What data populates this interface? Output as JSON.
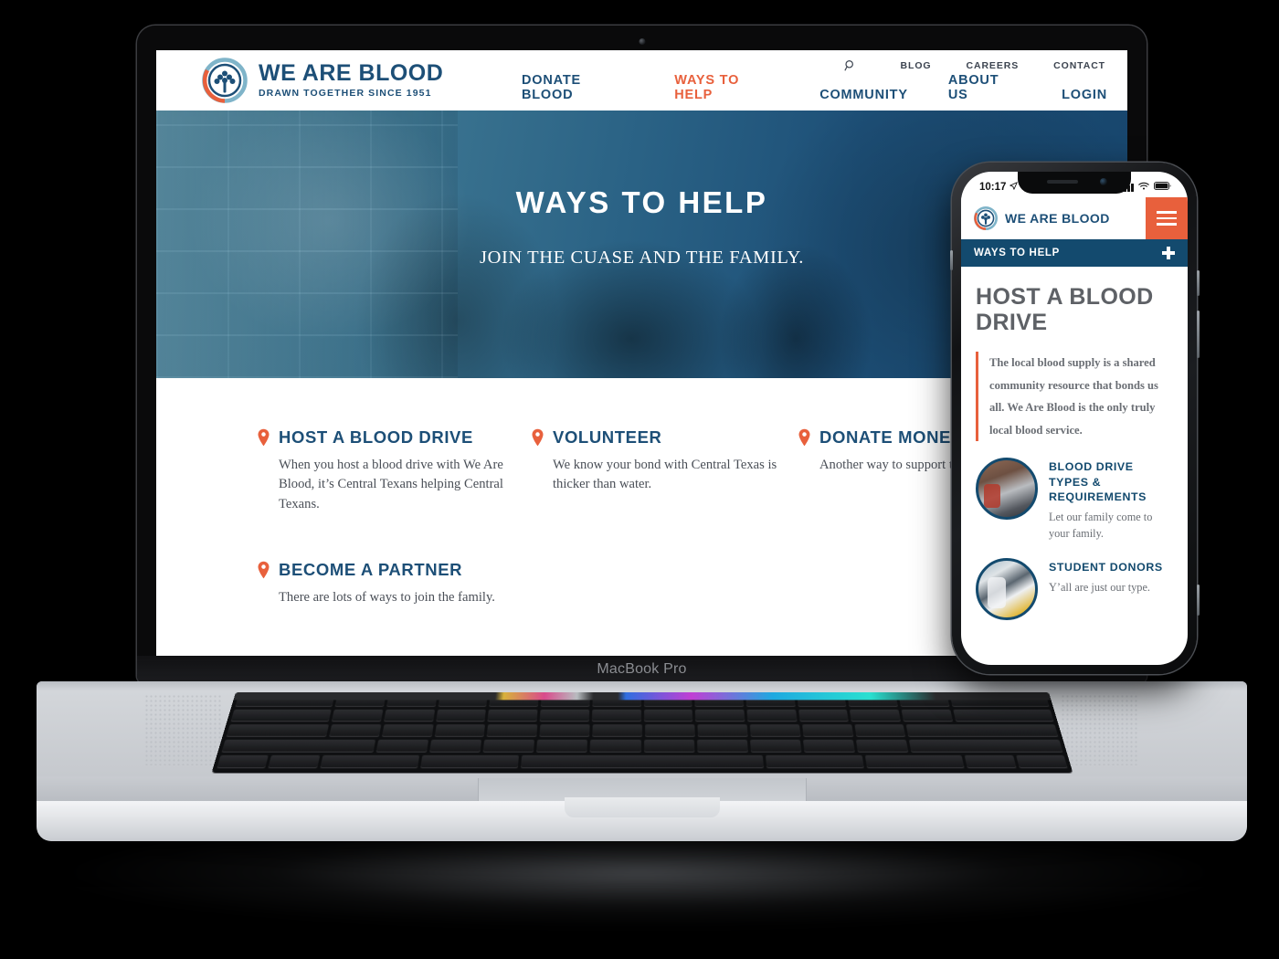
{
  "colors": {
    "navy": "#1d4f77",
    "deep_navy": "#134a6e",
    "orange": "#e8603c",
    "body_text": "#4a4f57"
  },
  "desktop": {
    "device_label": "MacBook Pro",
    "brand": {
      "name": "WE ARE BLOOD",
      "tagline": "DRAWN TOGETHER SINCE 1951",
      "logo_icon": "tree-in-circle-logo"
    },
    "nav_secondary": [
      {
        "label": "",
        "icon": "search-icon"
      },
      {
        "label": "BLOG"
      },
      {
        "label": "CAREERS"
      },
      {
        "label": "CONTACT"
      }
    ],
    "nav_primary": [
      {
        "label": "DONATE BLOOD",
        "active": false
      },
      {
        "label": "WAYS TO HELP",
        "active": true
      },
      {
        "label": "COMMUNITY",
        "active": false
      },
      {
        "label": "ABOUT US",
        "active": false
      },
      {
        "label": "LOGIN",
        "active": false
      }
    ],
    "hero": {
      "title": "WAYS TO HELP",
      "subtitle": "JOIN THE CUASE AND THE FAMILY."
    },
    "cards": [
      {
        "title": "HOST A BLOOD DRIVE",
        "body": "When you host a blood drive with We Are Blood, it’s Central Texans helping Central Texans.",
        "icon": "map-pin-icon"
      },
      {
        "title": "VOLUNTEER",
        "body": "We know your bond with Central Texas is thicker than water.",
        "icon": "map-pin-icon"
      },
      {
        "title": "DONATE MONEY",
        "body": "Another way to support the m join the family.",
        "icon": "map-pin-icon"
      },
      {
        "title": "BECOME A PARTNER",
        "body": "There are lots of ways to join the family.",
        "icon": "map-pin-icon"
      }
    ]
  },
  "phone": {
    "status": {
      "time": "10:17",
      "location_icon": "location-arrow-icon",
      "signal_icon": "cellular-bars-icon",
      "wifi_icon": "wifi-icon",
      "battery_icon": "battery-icon"
    },
    "brand": {
      "name": "WE ARE BLOOD",
      "logo_icon": "tree-in-circle-logo"
    },
    "menu_button": {
      "icon": "hamburger-menu-icon"
    },
    "section_bar": {
      "label": "WAYS TO HELP",
      "toggle_icon": "plus-icon"
    },
    "heading": "HOST A BLOOD DRIVE",
    "quote": "The local blood supply is a shared community resource that bonds us all. We Are Blood is the only truly local blood service.",
    "items": [
      {
        "title": "BLOOD DRIVE TYPES & REQUIREMENTS",
        "desc": "Let our family come to your family.",
        "thumb_icon": "people-photo-thumbnail"
      },
      {
        "title": "STUDENT DONORS",
        "desc": "Y’all are just our type.",
        "thumb_icon": "students-photo-thumbnail"
      }
    ]
  }
}
